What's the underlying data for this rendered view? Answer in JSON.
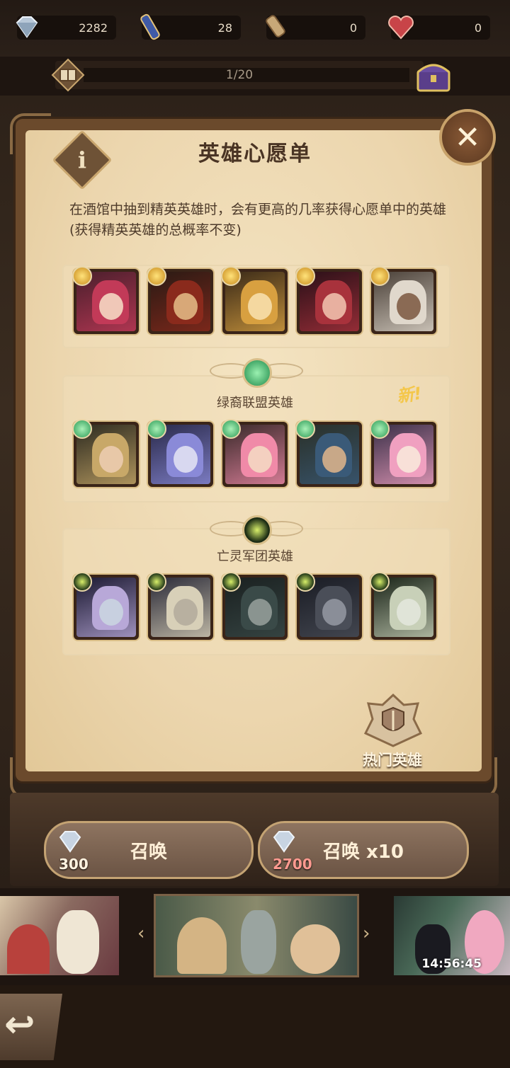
{
  "resources": [
    {
      "icon": "diamond-icon",
      "value": "2282"
    },
    {
      "icon": "scroll-icon",
      "value": "28"
    },
    {
      "icon": "faction-scroll-icon",
      "value": "0"
    },
    {
      "icon": "heart-icon",
      "value": "0"
    }
  ],
  "progress": {
    "label": "1/20",
    "fraction": 0.05
  },
  "dialog": {
    "title": "英雄心愿单",
    "description": "在酒馆中抽到精英英雄时，会有更高的几率获得心愿单中的英雄(获得精英英雄的总概率不变)",
    "close": "✕",
    "info": "i"
  },
  "groups": [
    {
      "title": "",
      "faction": "lightbearer",
      "new": "",
      "heroes": [
        "hero-1",
        "hero-2",
        "hero-3",
        "hero-4",
        "hero-5"
      ]
    },
    {
      "title": "绿裔联盟英雄",
      "faction": "wilder",
      "new": "新!",
      "heroes": [
        "hero-6",
        "hero-7",
        "hero-8",
        "hero-9",
        "hero-10"
      ]
    },
    {
      "title": "亡灵军团英雄",
      "faction": "graveborn",
      "new": "",
      "heroes": [
        "hero-11",
        "hero-12",
        "hero-13",
        "hero-14",
        "hero-15"
      ]
    }
  ],
  "hot_heroes_label": "热门英雄",
  "summon": [
    {
      "label": "召唤",
      "cost": "300"
    },
    {
      "label": "召唤 x10",
      "cost": "2700"
    }
  ],
  "banner_timer": "14:56:45",
  "colors": {
    "accent": "#c8a26a",
    "paper": "#f1dfba",
    "wilder": "#2b9a55",
    "graveborn": "#223818",
    "lightbearer": "#c88a1c"
  }
}
